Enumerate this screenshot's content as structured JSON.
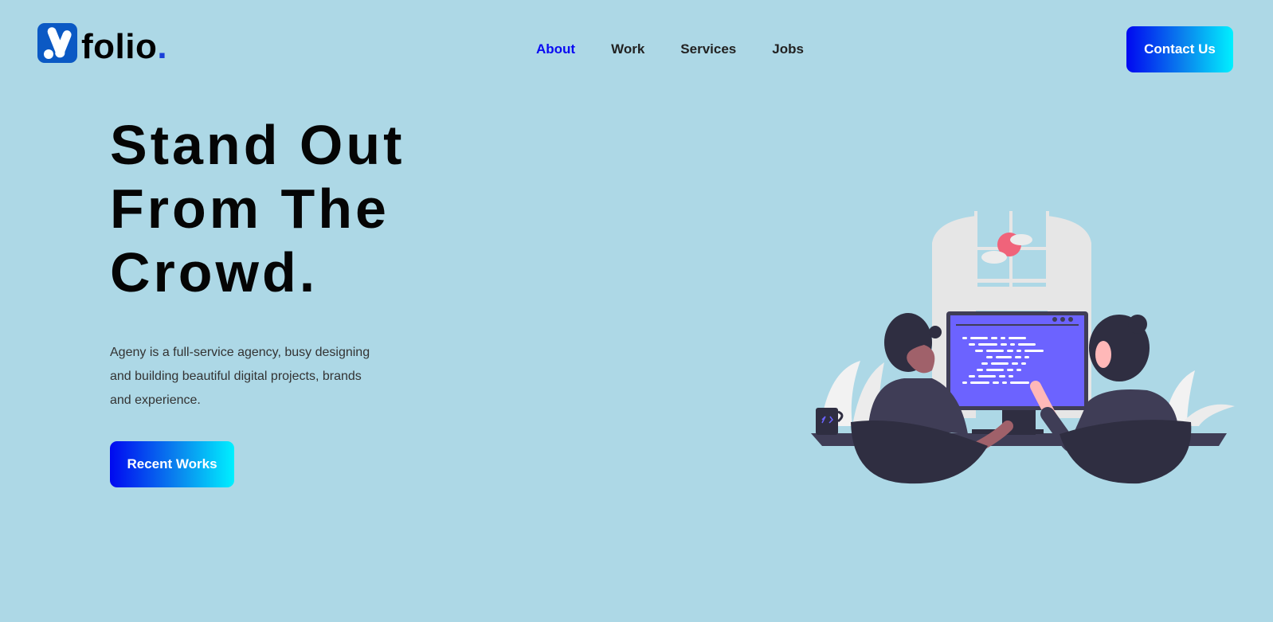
{
  "brand": {
    "logo_text": "folio",
    "logo_dot": ".",
    "logo_mark": "a-letter-logo-icon"
  },
  "nav": {
    "items": [
      {
        "label": "About",
        "active": true
      },
      {
        "label": "Work",
        "active": false
      },
      {
        "label": "Services",
        "active": false
      },
      {
        "label": "Jobs",
        "active": false
      }
    ]
  },
  "header": {
    "contact_label": "Contact Us"
  },
  "hero": {
    "title_lines": [
      "Stand Out",
      "From The",
      "Crowd."
    ],
    "description": "Ageny is a full-service agency, busy designing and building beautiful digital projects, brands and experience.",
    "cta_label": "Recent Works"
  },
  "colors": {
    "background": "#add8e6",
    "accent_active": "#0a0af2",
    "button_gradient_start": "#0008f0",
    "button_gradient_end": "#00f0ff",
    "monitor_screen": "#6c63ff"
  },
  "illustration": {
    "icon": "people-working-at-computer-illustration"
  }
}
